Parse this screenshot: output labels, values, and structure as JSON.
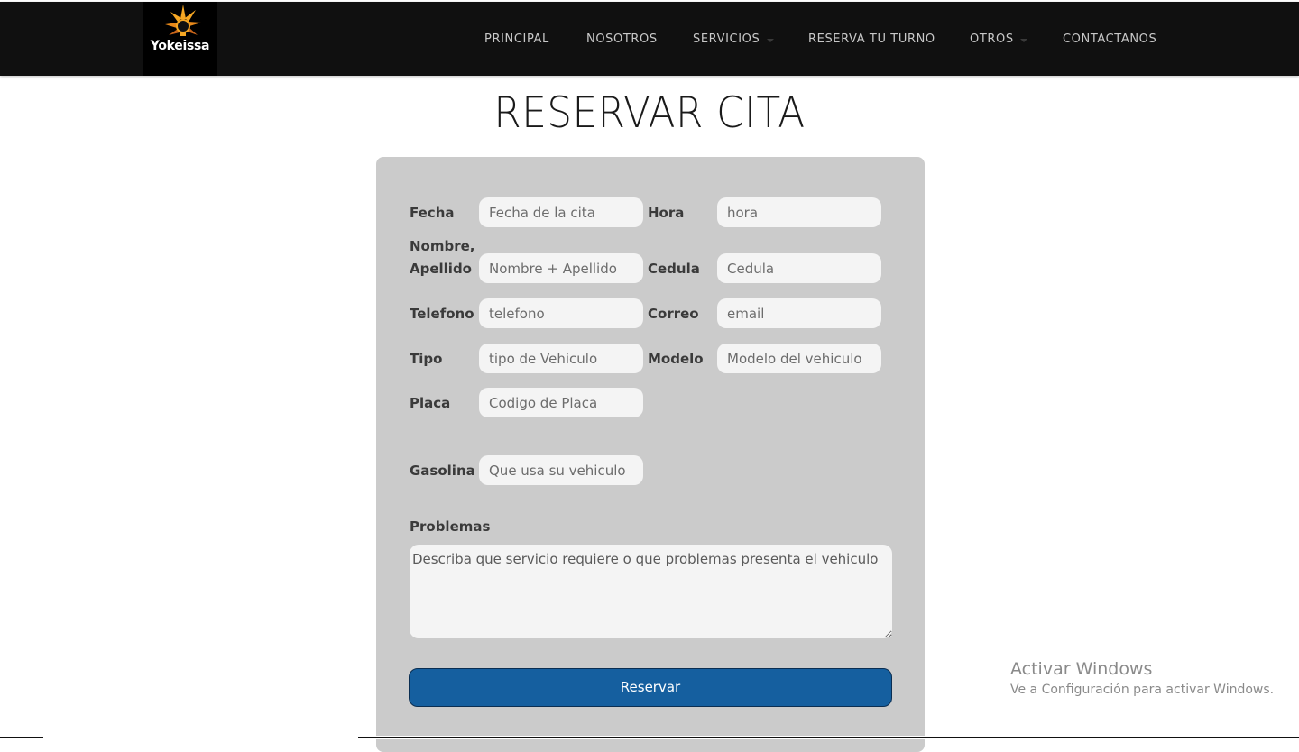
{
  "brand": {
    "logo_text": "Yokeissa"
  },
  "nav": {
    "items": [
      {
        "label": "PRINCIPAL"
      },
      {
        "label": "NOSOTROS"
      },
      {
        "label": "SERVICIOS",
        "has_dropdown": true
      },
      {
        "label": "RESERVA TU TURNO"
      },
      {
        "label": "OTROS",
        "has_dropdown": true
      },
      {
        "label": "CONTACTANOS"
      }
    ]
  },
  "page": {
    "title": "RESERVAR CITA"
  },
  "form": {
    "fecha": {
      "label": "Fecha",
      "placeholder": "Fecha de la cita",
      "value": ""
    },
    "hora": {
      "label": "Hora",
      "placeholder": "hora",
      "value": ""
    },
    "nombre": {
      "label_line1": "Nombre,",
      "label_line2": "Apellido",
      "placeholder": "Nombre + Apellido",
      "value": ""
    },
    "cedula": {
      "label": "Cedula",
      "placeholder": "Cedula",
      "value": ""
    },
    "telefono": {
      "label": "Telefono",
      "placeholder": "telefono",
      "value": ""
    },
    "correo": {
      "label": "Correo",
      "placeholder": "email",
      "value": ""
    },
    "tipo": {
      "label": "Tipo",
      "placeholder": "tipo de Vehiculo",
      "value": ""
    },
    "modelo": {
      "label": "Modelo",
      "placeholder": "Modelo del vehiculo",
      "value": ""
    },
    "placa": {
      "label": "Placa",
      "placeholder": "Codigo de Placa",
      "value": ""
    },
    "gasolina": {
      "label": "Gasolina",
      "placeholder": "Que usa su vehiculo",
      "value": ""
    },
    "problemas": {
      "label": "Problemas",
      "placeholder": "Describa que servicio requiere o que problemas presenta el vehiculo",
      "value": ""
    },
    "submit_label": "Reservar"
  },
  "watermark": {
    "title": "Activar Windows",
    "subtitle": "Ve a Configuración para activar Windows."
  },
  "colors": {
    "navbar_bg": "#101010",
    "panel_bg": "#cbcbcb",
    "input_bg": "#f4f4f4",
    "button_bg": "#155f9f",
    "logo_accent": "#f5a623"
  },
  "icons": {
    "logo": "sunburst-bulb-icon"
  }
}
